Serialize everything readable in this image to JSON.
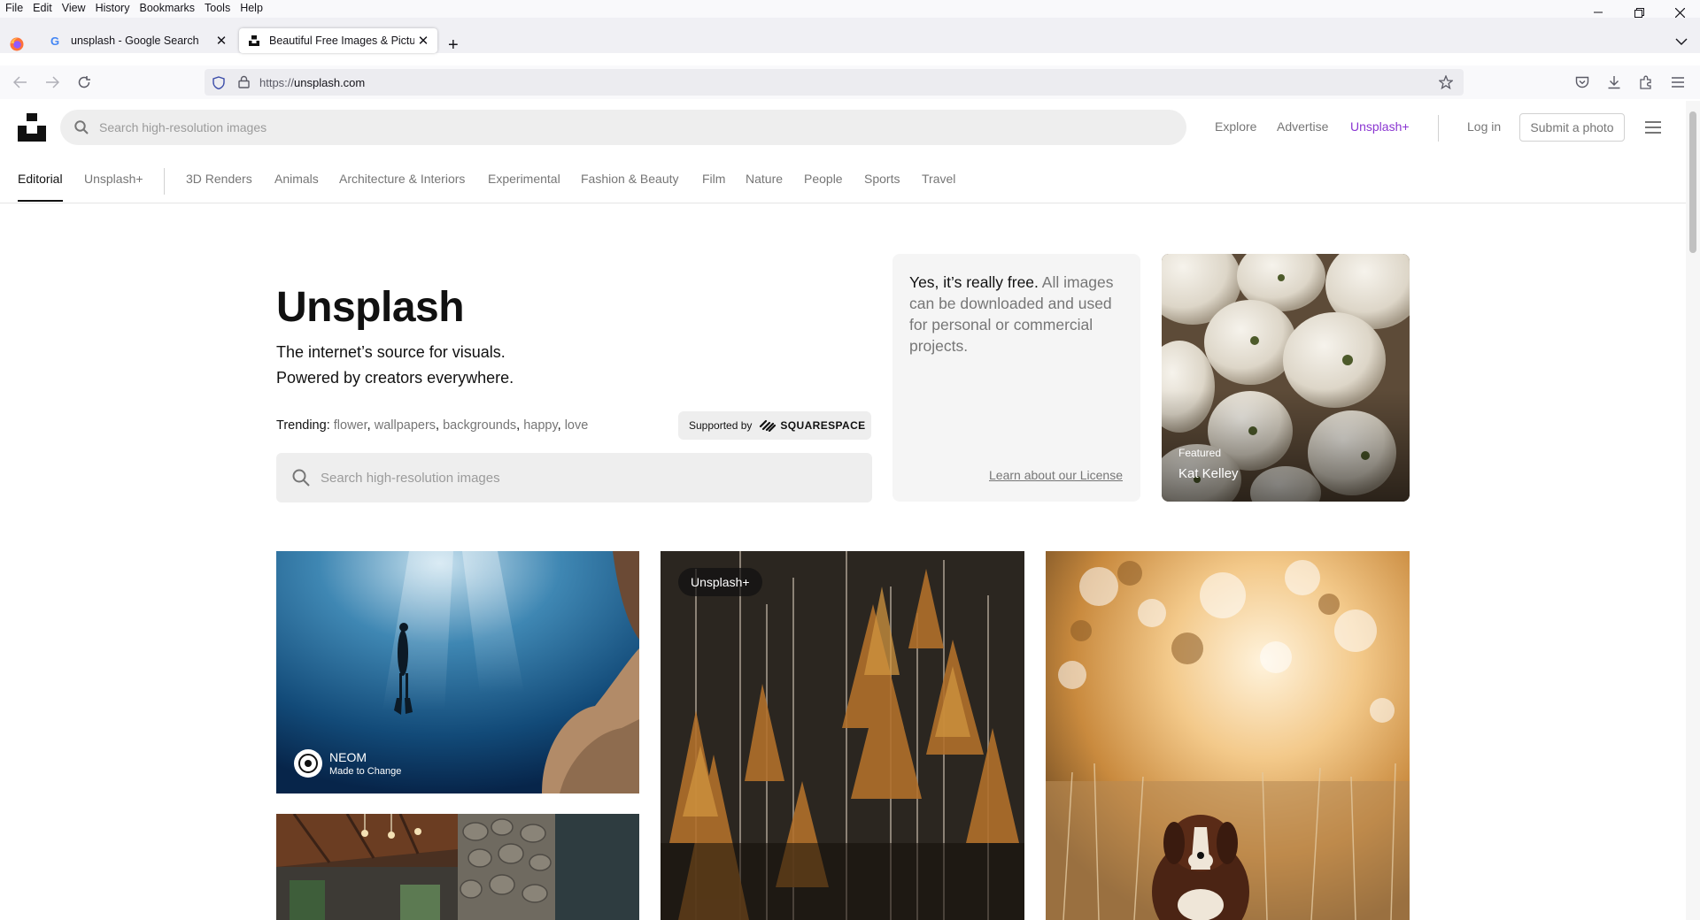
{
  "menubar": {
    "items": [
      "File",
      "Edit",
      "View",
      "History",
      "Bookmarks",
      "Tools",
      "Help"
    ]
  },
  "tabs": [
    {
      "title": "unsplash - Google Search",
      "active": false
    },
    {
      "title": "Beautiful Free Images & Pictures",
      "active": true
    }
  ],
  "urlbar": {
    "url_scheme": "https://",
    "url_host": "unsplash.com"
  },
  "site": {
    "search_placeholder": "Search high-resolution images",
    "header_links": [
      "Explore",
      "Advertise",
      "Unsplash+",
      "Log in"
    ],
    "submit_label": "Submit a photo",
    "categories": [
      "Editorial",
      "Unsplash+",
      "3D Renders",
      "Animals",
      "Architecture & Interiors",
      "Experimental",
      "Fashion & Beauty",
      "Film",
      "Nature",
      "People",
      "Sports",
      "Travel"
    ],
    "active_category": "Editorial"
  },
  "hero": {
    "title": "Unsplash",
    "subtitle_line1": "The internet’s source for visuals.",
    "subtitle_line2": "Powered by creators everywhere.",
    "trending_label": "Trending",
    "trending_items": [
      "flower",
      "wallpapers",
      "backgrounds",
      "happy",
      "love"
    ],
    "supported_by": "Supported by",
    "supported_brand": "SQUARESPACE",
    "search_placeholder": "Search high-resolution images"
  },
  "free_card": {
    "lead": "Yes, it’s really free.",
    "body": " All images can be downloaded and used for personal or commercial projects.",
    "license_link": "Learn about our License"
  },
  "featured": {
    "tag": "Featured",
    "name": "Kat Kelley"
  },
  "photos": {
    "sponsor_name": "NEOM",
    "sponsor_tagline": "Made to Change",
    "plus_badge": "Unsplash+"
  },
  "colors": {
    "brand_purple": "#8a35d1",
    "muted_text": "#767676"
  }
}
